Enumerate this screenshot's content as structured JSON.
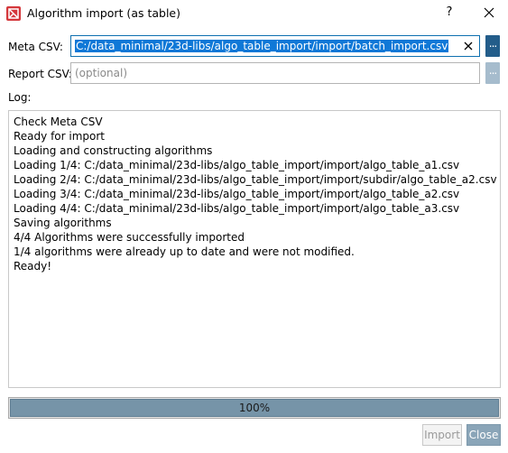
{
  "window": {
    "title": "Algorithm import (as table)",
    "help_label": "?",
    "close_icon": "close-icon",
    "app_icon": "app-logo-icon",
    "app_icon_color": "#d4373b"
  },
  "meta_csv": {
    "label": "Meta CSV:",
    "value": "C:/data_minimal/23d-libs/algo_table_import/import/batch_import.csv",
    "browse_label": "...",
    "clear_icon": "clear-icon"
  },
  "report_csv": {
    "label": "Report CSV:",
    "value": "",
    "placeholder": "(optional)",
    "browse_label": "..."
  },
  "log": {
    "label": "Log:",
    "lines": [
      "Check Meta CSV",
      "Ready for import",
      "Loading and constructing algorithms",
      "Loading 1/4: C:/data_minimal/23d-libs/algo_table_import/import/algo_table_a1.csv",
      "Loading 2/4: C:/data_minimal/23d-libs/algo_table_import/import/subdir/algo_table_a2.csv",
      "Loading 3/4: C:/data_minimal/23d-libs/algo_table_import/import/algo_table_a2.csv",
      "Loading 4/4: C:/data_minimal/23d-libs/algo_table_import/import/algo_table_a3.csv",
      "Saving algorithms",
      "4/4 Algorithms were successfully imported",
      "1/4 algorithms were already up to date and were not modified.",
      "Ready!"
    ]
  },
  "progress": {
    "value": 1.0,
    "label": "100%"
  },
  "buttons": {
    "import_label": "Import",
    "close_label": "Close"
  },
  "colors": {
    "accent": "#235d8a",
    "selection": "#0f78d7",
    "progress_fill": "#7694a8"
  }
}
